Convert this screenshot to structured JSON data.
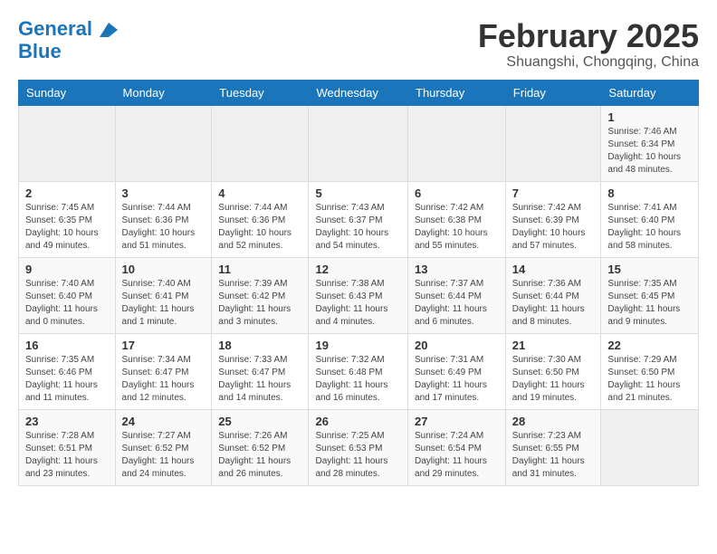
{
  "header": {
    "logo_line1": "General",
    "logo_line2": "Blue",
    "month_title": "February 2025",
    "location": "Shuangshi, Chongqing, China"
  },
  "weekdays": [
    "Sunday",
    "Monday",
    "Tuesday",
    "Wednesday",
    "Thursday",
    "Friday",
    "Saturday"
  ],
  "weeks": [
    [
      {
        "day": "",
        "content": ""
      },
      {
        "day": "",
        "content": ""
      },
      {
        "day": "",
        "content": ""
      },
      {
        "day": "",
        "content": ""
      },
      {
        "day": "",
        "content": ""
      },
      {
        "day": "",
        "content": ""
      },
      {
        "day": "1",
        "content": "Sunrise: 7:46 AM\nSunset: 6:34 PM\nDaylight: 10 hours and 48 minutes."
      }
    ],
    [
      {
        "day": "2",
        "content": "Sunrise: 7:45 AM\nSunset: 6:35 PM\nDaylight: 10 hours and 49 minutes."
      },
      {
        "day": "3",
        "content": "Sunrise: 7:44 AM\nSunset: 6:36 PM\nDaylight: 10 hours and 51 minutes."
      },
      {
        "day": "4",
        "content": "Sunrise: 7:44 AM\nSunset: 6:36 PM\nDaylight: 10 hours and 52 minutes."
      },
      {
        "day": "5",
        "content": "Sunrise: 7:43 AM\nSunset: 6:37 PM\nDaylight: 10 hours and 54 minutes."
      },
      {
        "day": "6",
        "content": "Sunrise: 7:42 AM\nSunset: 6:38 PM\nDaylight: 10 hours and 55 minutes."
      },
      {
        "day": "7",
        "content": "Sunrise: 7:42 AM\nSunset: 6:39 PM\nDaylight: 10 hours and 57 minutes."
      },
      {
        "day": "8",
        "content": "Sunrise: 7:41 AM\nSunset: 6:40 PM\nDaylight: 10 hours and 58 minutes."
      }
    ],
    [
      {
        "day": "9",
        "content": "Sunrise: 7:40 AM\nSunset: 6:40 PM\nDaylight: 11 hours and 0 minutes."
      },
      {
        "day": "10",
        "content": "Sunrise: 7:40 AM\nSunset: 6:41 PM\nDaylight: 11 hours and 1 minute."
      },
      {
        "day": "11",
        "content": "Sunrise: 7:39 AM\nSunset: 6:42 PM\nDaylight: 11 hours and 3 minutes."
      },
      {
        "day": "12",
        "content": "Sunrise: 7:38 AM\nSunset: 6:43 PM\nDaylight: 11 hours and 4 minutes."
      },
      {
        "day": "13",
        "content": "Sunrise: 7:37 AM\nSunset: 6:44 PM\nDaylight: 11 hours and 6 minutes."
      },
      {
        "day": "14",
        "content": "Sunrise: 7:36 AM\nSunset: 6:44 PM\nDaylight: 11 hours and 8 minutes."
      },
      {
        "day": "15",
        "content": "Sunrise: 7:35 AM\nSunset: 6:45 PM\nDaylight: 11 hours and 9 minutes."
      }
    ],
    [
      {
        "day": "16",
        "content": "Sunrise: 7:35 AM\nSunset: 6:46 PM\nDaylight: 11 hours and 11 minutes."
      },
      {
        "day": "17",
        "content": "Sunrise: 7:34 AM\nSunset: 6:47 PM\nDaylight: 11 hours and 12 minutes."
      },
      {
        "day": "18",
        "content": "Sunrise: 7:33 AM\nSunset: 6:47 PM\nDaylight: 11 hours and 14 minutes."
      },
      {
        "day": "19",
        "content": "Sunrise: 7:32 AM\nSunset: 6:48 PM\nDaylight: 11 hours and 16 minutes."
      },
      {
        "day": "20",
        "content": "Sunrise: 7:31 AM\nSunset: 6:49 PM\nDaylight: 11 hours and 17 minutes."
      },
      {
        "day": "21",
        "content": "Sunrise: 7:30 AM\nSunset: 6:50 PM\nDaylight: 11 hours and 19 minutes."
      },
      {
        "day": "22",
        "content": "Sunrise: 7:29 AM\nSunset: 6:50 PM\nDaylight: 11 hours and 21 minutes."
      }
    ],
    [
      {
        "day": "23",
        "content": "Sunrise: 7:28 AM\nSunset: 6:51 PM\nDaylight: 11 hours and 23 minutes."
      },
      {
        "day": "24",
        "content": "Sunrise: 7:27 AM\nSunset: 6:52 PM\nDaylight: 11 hours and 24 minutes."
      },
      {
        "day": "25",
        "content": "Sunrise: 7:26 AM\nSunset: 6:52 PM\nDaylight: 11 hours and 26 minutes."
      },
      {
        "day": "26",
        "content": "Sunrise: 7:25 AM\nSunset: 6:53 PM\nDaylight: 11 hours and 28 minutes."
      },
      {
        "day": "27",
        "content": "Sunrise: 7:24 AM\nSunset: 6:54 PM\nDaylight: 11 hours and 29 minutes."
      },
      {
        "day": "28",
        "content": "Sunrise: 7:23 AM\nSunset: 6:55 PM\nDaylight: 11 hours and 31 minutes."
      },
      {
        "day": "",
        "content": ""
      }
    ]
  ]
}
